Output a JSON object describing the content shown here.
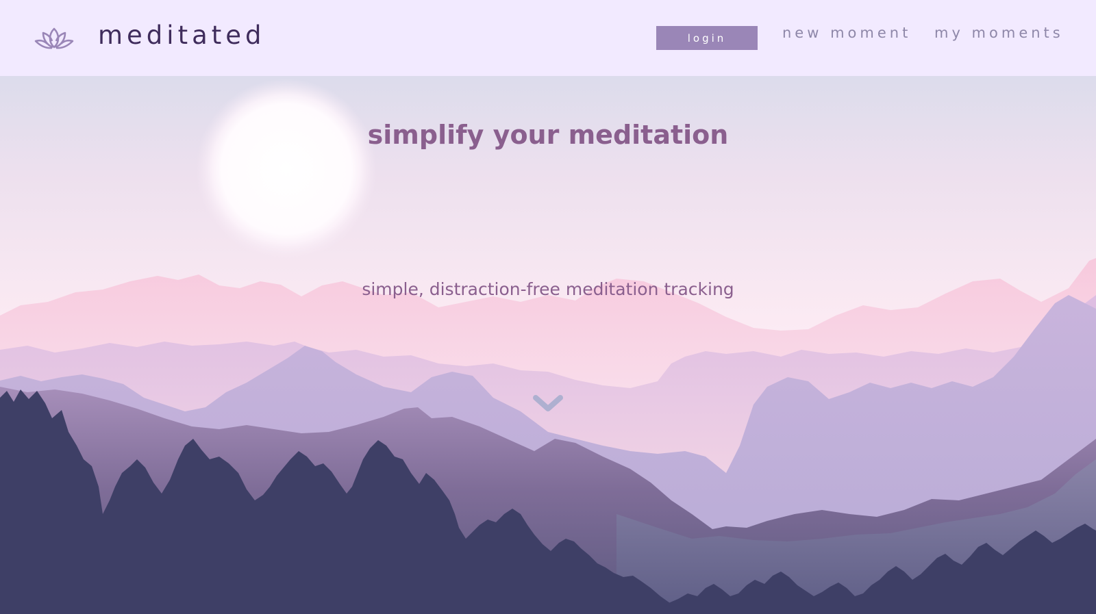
{
  "header": {
    "brand": "meditated",
    "logo_icon": "lotus-icon",
    "login_label": "login",
    "nav": [
      {
        "label": "new moment"
      },
      {
        "label": "my moments"
      }
    ]
  },
  "hero": {
    "title": "simplify your meditation",
    "subtitle": "simple, distraction-free meditation tracking",
    "scroll_icon": "chevron-down-icon"
  },
  "colors": {
    "header_bg": "#f2eaff",
    "brand_text": "#3f2c5c",
    "button_bg": "#9a86b7",
    "nav_text": "#8e87a8",
    "hero_text": "#8a5f8e",
    "chevron": "#aeb0d0",
    "forest": "#3e3f66"
  }
}
